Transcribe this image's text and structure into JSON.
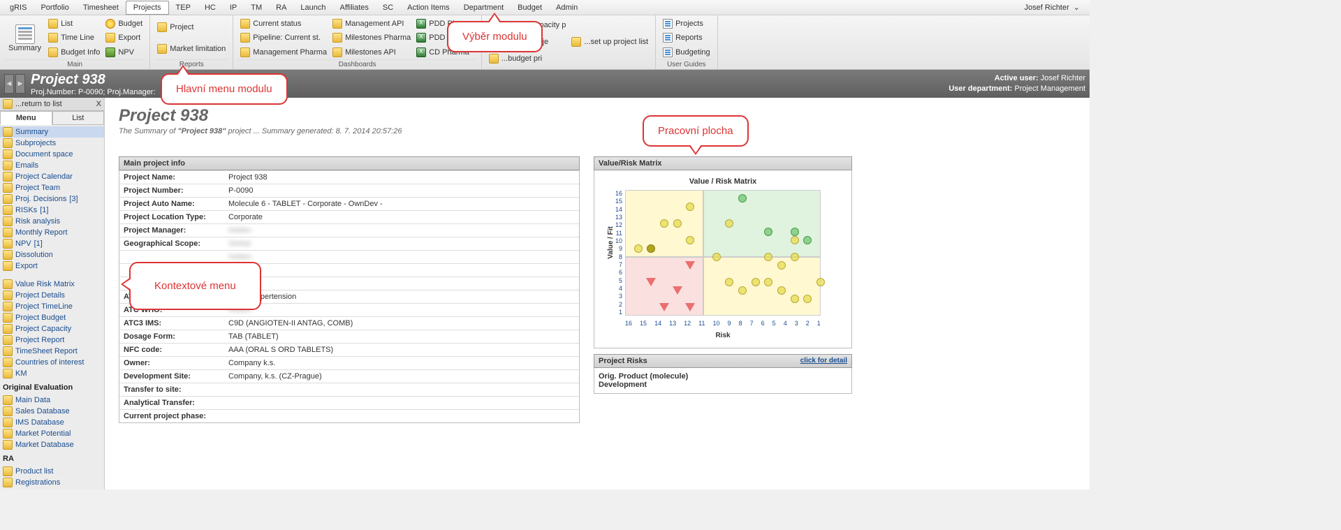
{
  "menubar": {
    "items": [
      "gRIS",
      "Portfolio",
      "Timesheet",
      "Projects",
      "TEP",
      "HC",
      "IP",
      "TM",
      "RA",
      "Launch",
      "Affiliates",
      "SC",
      "Action Items",
      "Department",
      "Budget",
      "Admin"
    ],
    "active_index": 3,
    "user": "Josef Richter"
  },
  "ribbon": {
    "groups": [
      {
        "title": "Main",
        "big": {
          "label": "Summary"
        },
        "cols": [
          [
            {
              "icon": "folder",
              "label": "List"
            },
            {
              "icon": "folder",
              "label": "Time Line"
            },
            {
              "icon": "folder",
              "label": "Budget Info"
            }
          ],
          [
            {
              "icon": "budget",
              "label": "Budget"
            },
            {
              "icon": "folder",
              "label": "Export"
            },
            {
              "icon": "npv",
              "label": "NPV"
            }
          ]
        ]
      },
      {
        "title": "Reports",
        "cols": [
          [
            {
              "icon": "folder",
              "label": "Project"
            },
            {
              "icon": "folder",
              "label": "Market limitation"
            }
          ]
        ]
      },
      {
        "title": "Dashboards",
        "cols": [
          [
            {
              "icon": "folder",
              "label": "Current status"
            },
            {
              "icon": "folder",
              "label": "Pipeline: Current st."
            },
            {
              "icon": "folder",
              "label": "Management Pharma"
            }
          ],
          [
            {
              "icon": "folder",
              "label": "Management API"
            },
            {
              "icon": "folder",
              "label": "Milestones Pharma"
            },
            {
              "icon": "folder",
              "label": "Milestones API"
            }
          ],
          [
            {
              "icon": "excel",
              "label": "PDD Pharma"
            },
            {
              "icon": "excel",
              "label": "PDD API"
            },
            {
              "icon": "excel",
              "label": "CD Pharma"
            }
          ]
        ]
      },
      {
        "title": "",
        "cols": [
          [
            {
              "icon": "folder",
              "label": "...create capacity p"
            },
            {
              "icon": "folder",
              "label": "...create proje"
            },
            {
              "icon": "folder",
              "label": "...budget pri"
            }
          ],
          [
            {
              "icon": "folder",
              "label": "...set up project list"
            }
          ]
        ]
      },
      {
        "title": "User Guides",
        "cols": [
          [
            {
              "icon": "report",
              "label": "Projects"
            },
            {
              "icon": "report",
              "label": "Reports"
            },
            {
              "icon": "report",
              "label": "Budgeting"
            }
          ]
        ]
      }
    ]
  },
  "project_header": {
    "title": "Project 938",
    "sub": "Proj.Number: P-0090; Proj.Manager:",
    "active_user_label": "Active user:",
    "active_user": "Josef Richter",
    "dept_label": "User department:",
    "dept": "Project Management"
  },
  "sidebar": {
    "return": "...return to list",
    "close": "X",
    "tabs": [
      "Menu",
      "List"
    ],
    "active_tab": 0,
    "group1": [
      {
        "label": "Summary",
        "selected": true
      },
      {
        "label": "Subprojects"
      },
      {
        "label": "Document space"
      },
      {
        "label": "Emails"
      },
      {
        "label": "Project Calendar"
      },
      {
        "label": "Project Team"
      },
      {
        "label": "Proj. Decisions",
        "count": "[3]"
      },
      {
        "label": "RISKs",
        "count": "[1]"
      },
      {
        "label": "Risk analysis"
      },
      {
        "label": "Monthly Report"
      },
      {
        "label": "NPV",
        "count": "[1]"
      },
      {
        "label": "Dissolution"
      },
      {
        "label": "Export"
      }
    ],
    "group2": [
      {
        "label": "Value Risk Matrix"
      },
      {
        "label": "Project Details"
      },
      {
        "label": "Project TimeLine"
      },
      {
        "label": "Project Budget"
      },
      {
        "label": "Project Capacity"
      },
      {
        "label": "Project Report"
      },
      {
        "label": "TimeSheet Report"
      },
      {
        "label": "Countries of interest"
      },
      {
        "label": "KM"
      }
    ],
    "section_titles": {
      "orig": "Original Evaluation",
      "ra": "RA"
    },
    "group3": [
      {
        "label": "Main Data"
      },
      {
        "label": "Sales Database"
      },
      {
        "label": "IMS Database"
      },
      {
        "label": "Market Potential"
      },
      {
        "label": "Market Database"
      }
    ],
    "group4": [
      {
        "label": "Product list"
      },
      {
        "label": "Registrations"
      }
    ]
  },
  "content": {
    "title": "Project 938",
    "sub_prefix": "The Summary of ",
    "sub_bold": "\"Project 938\"",
    "sub_suffix": " project   ... Summary generated: 8. 7. 2014 20:57:26"
  },
  "main_info": {
    "header": "Main project info",
    "rows": [
      {
        "label": "Project Name:",
        "value": "Project 938"
      },
      {
        "label": "Project Number:",
        "value": "P-0090"
      },
      {
        "label": "Project Auto Name:",
        "value": "Molecule 6 - TABLET - Corporate - OwnDev -"
      },
      {
        "label": "Project Location Type:",
        "value": "Corporate"
      },
      {
        "label": "Project Manager:",
        "value": "hidden",
        "blur": true
      },
      {
        "label": "Geographical Scope:",
        "value": "Global",
        "blur": true
      },
      {
        "label": "",
        "value": "hidden",
        "blur": true
      },
      {
        "label": "",
        "value": "hidden",
        "blur": true
      },
      {
        "label": "",
        "value": "hidden",
        "blur": true
      },
      {
        "label": "ATC:",
        "value": "CVS - Hypertension"
      },
      {
        "label": "ATC WHO:",
        "value": "hidden",
        "blur": true
      },
      {
        "label": "ATC3 IMS:",
        "value": " C9D (ANGIOTEN-II ANTAG, COMB)"
      },
      {
        "label": "Dosage Form:",
        "value": "TAB (TABLET)"
      },
      {
        "label": "NFC code:",
        "value": "AAA (ORAL S ORD TABLETS)"
      },
      {
        "label": "Owner:",
        "value": "Company k.s."
      },
      {
        "label": "Development Site:",
        "value": "Company, k.s. (CZ-Prague)"
      },
      {
        "label": "Transfer to site:",
        "value": ""
      },
      {
        "label": "Analytical Transfer:",
        "value": ""
      },
      {
        "label": "Current project phase:",
        "value": ""
      }
    ]
  },
  "matrix": {
    "header": "Value/Risk Matrix",
    "chart_title": "Value / Risk Matrix",
    "y_label": "Value / Fit",
    "x_label": "Risk"
  },
  "chart_data": {
    "type": "scatter",
    "xlabel": "Risk",
    "ylabel": "Value / Fit",
    "x_ticks": [
      16,
      15,
      14,
      13,
      12,
      11,
      10,
      9,
      8,
      7,
      6,
      5,
      4,
      3,
      2,
      1
    ],
    "y_ticks": [
      1,
      2,
      3,
      4,
      5,
      6,
      7,
      8,
      9,
      10,
      11,
      12,
      13,
      14,
      15,
      16
    ],
    "xlim": [
      16,
      1
    ],
    "ylim": [
      1,
      16
    ],
    "quadrants": [
      {
        "x": [
          16,
          10
        ],
        "y": [
          8,
          16
        ],
        "color": "#fff8d0"
      },
      {
        "x": [
          10,
          1
        ],
        "y": [
          8,
          16
        ],
        "color": "#dff3df"
      },
      {
        "x": [
          16,
          10
        ],
        "y": [
          1,
          8
        ],
        "color": "#fbe0e0"
      },
      {
        "x": [
          10,
          1
        ],
        "y": [
          1,
          8
        ],
        "color": "#fff8d0"
      }
    ],
    "series": [
      {
        "name": "yellow",
        "shape": "circle",
        "color": "#e3d850",
        "points": [
          {
            "x": 15,
            "y": 9
          },
          {
            "x": 13,
            "y": 12
          },
          {
            "x": 12,
            "y": 12
          },
          {
            "x": 11,
            "y": 10
          },
          {
            "x": 11,
            "y": 14
          },
          {
            "x": 8,
            "y": 12
          },
          {
            "x": 9,
            "y": 8
          },
          {
            "x": 8,
            "y": 5
          },
          {
            "x": 7,
            "y": 4
          },
          {
            "x": 6,
            "y": 5
          },
          {
            "x": 5,
            "y": 8
          },
          {
            "x": 5,
            "y": 5
          },
          {
            "x": 4,
            "y": 7
          },
          {
            "x": 4,
            "y": 4
          },
          {
            "x": 3,
            "y": 3
          },
          {
            "x": 2,
            "y": 3
          },
          {
            "x": 3,
            "y": 8
          },
          {
            "x": 3,
            "y": 10
          },
          {
            "x": 1,
            "y": 5
          }
        ]
      },
      {
        "name": "green",
        "shape": "circle",
        "color": "#7bc97b",
        "points": [
          {
            "x": 7,
            "y": 15
          },
          {
            "x": 5,
            "y": 11
          },
          {
            "x": 3,
            "y": 11
          },
          {
            "x": 2,
            "y": 10
          }
        ]
      },
      {
        "name": "highlight",
        "shape": "circle",
        "color": "#a69a12",
        "points": [
          {
            "x": 14,
            "y": 9
          }
        ]
      },
      {
        "name": "red",
        "shape": "triangle-down",
        "color": "#e05a5a",
        "points": [
          {
            "x": 14,
            "y": 5
          },
          {
            "x": 13,
            "y": 2
          },
          {
            "x": 12,
            "y": 4
          },
          {
            "x": 11,
            "y": 7
          },
          {
            "x": 11,
            "y": 2
          }
        ]
      }
    ]
  },
  "risks": {
    "header": "Project Risks",
    "click": "click for detail",
    "line1": "Orig. Product (molecule)",
    "line2": "Development"
  },
  "callouts": {
    "module": "Výběr modulu",
    "main": "Hlavní menu modulu",
    "work": "Pracovní plocha",
    "ctx": "Kontextové menu"
  }
}
